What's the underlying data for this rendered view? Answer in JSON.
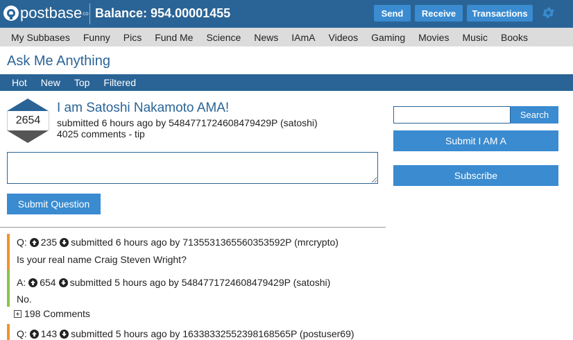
{
  "brand": {
    "name": "postbase",
    "suffix": "co"
  },
  "balance_label": "Balance: 954.00001455",
  "top_buttons": {
    "send": "Send",
    "receive": "Receive",
    "transactions": "Transactions"
  },
  "categories": [
    "My Subbases",
    "Funny",
    "Pics",
    "Fund Me",
    "Science",
    "News",
    "IAmA",
    "Videos",
    "Gaming",
    "Movies",
    "Music",
    "Books"
  ],
  "page_title": "Ask Me Anything",
  "sort_tabs": [
    "Hot",
    "New",
    "Top",
    "Filtered"
  ],
  "post": {
    "score": "2654",
    "title": "I am Satoshi Nakamoto AMA!",
    "meta": "submitted 6 hours ago by 5484771724608479429P (satoshi)",
    "comments": "4025 comments - tip"
  },
  "question_box": {
    "value": "",
    "submit_label": "Submit Question"
  },
  "thread": [
    {
      "kind": "Q",
      "prefix": "Q:",
      "score": "235",
      "meta": "submitted 6 hours ago by 7135531365560353592P (mrcrypto)",
      "body": "Is your real name Craig Steven Wright?"
    },
    {
      "kind": "A",
      "prefix": "A:",
      "score": "654",
      "meta": "submitted 5 hours ago by 5484771724608479429P (satoshi)",
      "body": "No."
    },
    {
      "kind": "Q",
      "prefix": "Q:",
      "score": "143",
      "meta": "submitted 5 hours ago by 16338332552398168565P (postuser69)",
      "body": ""
    }
  ],
  "expand_label": "198 Comments",
  "sidebar": {
    "search_value": "",
    "search_button": "Search",
    "submit_iama": "Submit I AM A",
    "subscribe": "Subscribe"
  },
  "colors": {
    "brand_blue": "#2a6496",
    "button_blue": "#3a8bd0",
    "question_bar": "#f0932b",
    "answer_bar": "#8bc34a",
    "nav_gray": "#dcdcdc"
  },
  "icons": [
    "postbase-logo-icon",
    "gear-icon",
    "upvote-arrow",
    "downvote-arrow",
    "up-circle-icon",
    "down-circle-icon",
    "plus-box-icon"
  ]
}
